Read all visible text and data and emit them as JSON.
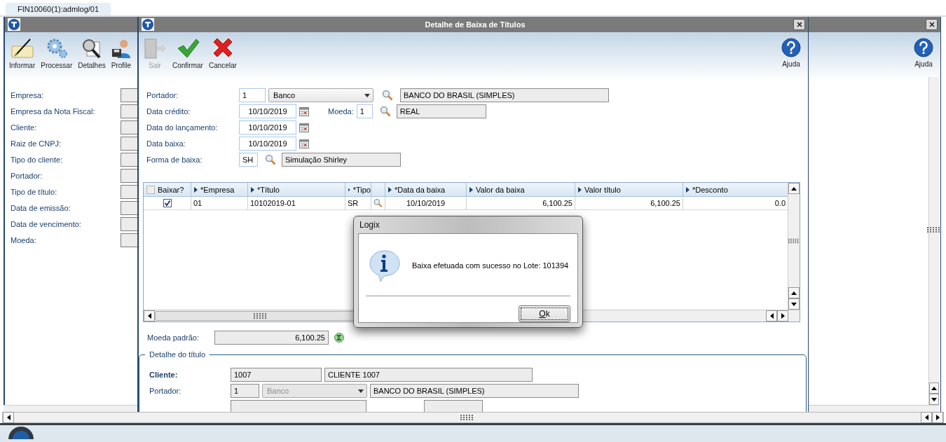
{
  "tab": {
    "label": "FIN10060(1):admlog/01",
    "selected": true
  },
  "main_window": {
    "toolbar": [
      {
        "label": "Informar"
      },
      {
        "label": "Processar"
      },
      {
        "label": "Detalhes"
      },
      {
        "label": "Profile"
      }
    ],
    "help": "Ajuda",
    "filter_labels": [
      "Empresa:",
      "Empresa da Nota Fiscal:",
      "Cliente:",
      "Raiz de CNPJ:",
      "Tipo do cliente:",
      "Portador:",
      "Tipo de título:",
      "Data de emissão:",
      "Data de vencimento:",
      "Moeda:"
    ]
  },
  "detail_window": {
    "title": "Detalhe de Baixa de Títulos",
    "toolbar": [
      {
        "label": "Sair",
        "disabled": true
      },
      {
        "label": "Confirmar",
        "disabled": false
      },
      {
        "label": "Cancelar",
        "disabled": false
      }
    ],
    "help": "Ajuda",
    "portador": {
      "label": "Portador:",
      "code": "1",
      "type": "Banco",
      "disabled": false,
      "name": "BANCO DO BRASIL (SIMPLES)"
    },
    "dates": [
      {
        "label": "Data crédito:",
        "value": "10/10/2019"
      },
      {
        "label": "Data do lançamento:",
        "value": "10/10/2019"
      },
      {
        "label": "Data baixa:",
        "value": "10/10/2019"
      }
    ],
    "moeda": {
      "label": "Moeda:",
      "code": "1",
      "name": "REAL"
    },
    "forma_baixa": {
      "label": "Forma de  baixa:",
      "code": "SH",
      "name": "Simulação Shirley"
    },
    "table": {
      "header_checked": false,
      "columns": [
        "Baixar?",
        "*Empresa",
        "*Título",
        "*Tipo",
        "*Data da baixa",
        "Valor da baixa",
        "Valor título",
        "*Desconto"
      ],
      "rows": [
        {
          "checked": true,
          "empresa": "01",
          "titulo": "10102019-01",
          "tipo": "SR",
          "data": "10/10/2019",
          "valor_baixa": "6,100.25",
          "valor_titulo": "6,100.25",
          "desconto": "0.0"
        }
      ]
    },
    "moeda_padrao": {
      "label": "Moeda padrão:",
      "value": "6,100.25"
    },
    "detalhe_titulo": {
      "legend": "Detalhe do título",
      "cliente": {
        "label": "Cliente:",
        "code": "1007",
        "name": "CLIENTE 1007"
      },
      "portador": {
        "label": "Portador:",
        "code": "1",
        "type": "Banco",
        "disabled": true,
        "name": "BANCO DO BRASIL (SIMPLES)"
      }
    }
  },
  "message": {
    "title": "Logix",
    "text": "Baixa efetuada com sucesso no Lote: 101394",
    "button": "Ok"
  }
}
